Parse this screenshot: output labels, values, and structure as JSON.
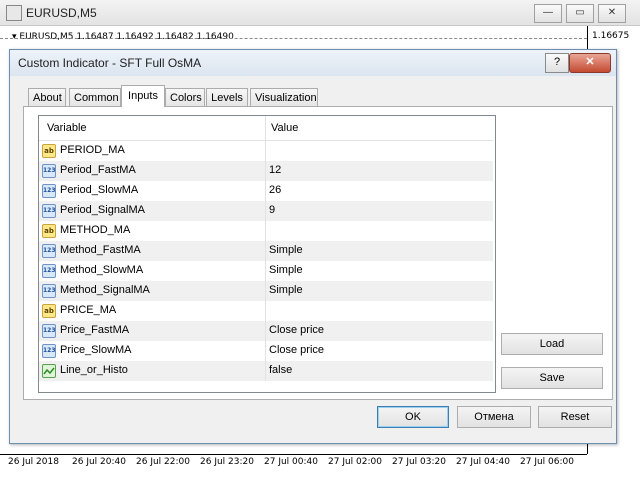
{
  "window": {
    "title": "EURUSD,M5"
  },
  "chart": {
    "header": "EURUSD,M5  1.16487 1.16492 1.16482 1.16490",
    "price_label": "1.16675",
    "time_labels": [
      "26 Jul 2018",
      "26 Jul 20:40",
      "26 Jul 22:00",
      "26 Jul 23:20",
      "27 Jul 00:40",
      "27 Jul 02:00",
      "27 Jul 03:20",
      "27 Jul 04:40",
      "27 Jul 06:00"
    ]
  },
  "dialog": {
    "title": "Custom Indicator - SFT Full OsMA",
    "help": "?",
    "close": "✕",
    "tabs": [
      "About",
      "Common",
      "Inputs",
      "Colors",
      "Levels",
      "Visualization"
    ],
    "active_tab": "Inputs",
    "columns": {
      "variable": "Variable",
      "value": "Value"
    },
    "rows": [
      {
        "type": "ab",
        "name": "PERIOD_MA",
        "value": ""
      },
      {
        "type": "num",
        "name": "Period_FastMA",
        "value": "12"
      },
      {
        "type": "num",
        "name": "Period_SlowMA",
        "value": "26"
      },
      {
        "type": "num",
        "name": "Period_SignalMA",
        "value": "9"
      },
      {
        "type": "ab",
        "name": "METHOD_MA",
        "value": ""
      },
      {
        "type": "num",
        "name": "Method_FastMA",
        "value": "Simple"
      },
      {
        "type": "num",
        "name": "Method_SlowMA",
        "value": "Simple"
      },
      {
        "type": "num",
        "name": "Method_SignalMA",
        "value": "Simple"
      },
      {
        "type": "ab",
        "name": "PRICE_MA",
        "value": ""
      },
      {
        "type": "num",
        "name": "Price_FastMA",
        "value": "Close price"
      },
      {
        "type": "num",
        "name": "Price_SlowMA",
        "value": "Close price"
      },
      {
        "type": "bool",
        "name": "Line_or_Histo",
        "value": "false"
      }
    ],
    "buttons": {
      "load": "Load",
      "save": "Save",
      "ok": "OK",
      "cancel": "Отмена",
      "reset": "Reset"
    },
    "icon_text": {
      "ab": "ab",
      "num": "123"
    }
  }
}
